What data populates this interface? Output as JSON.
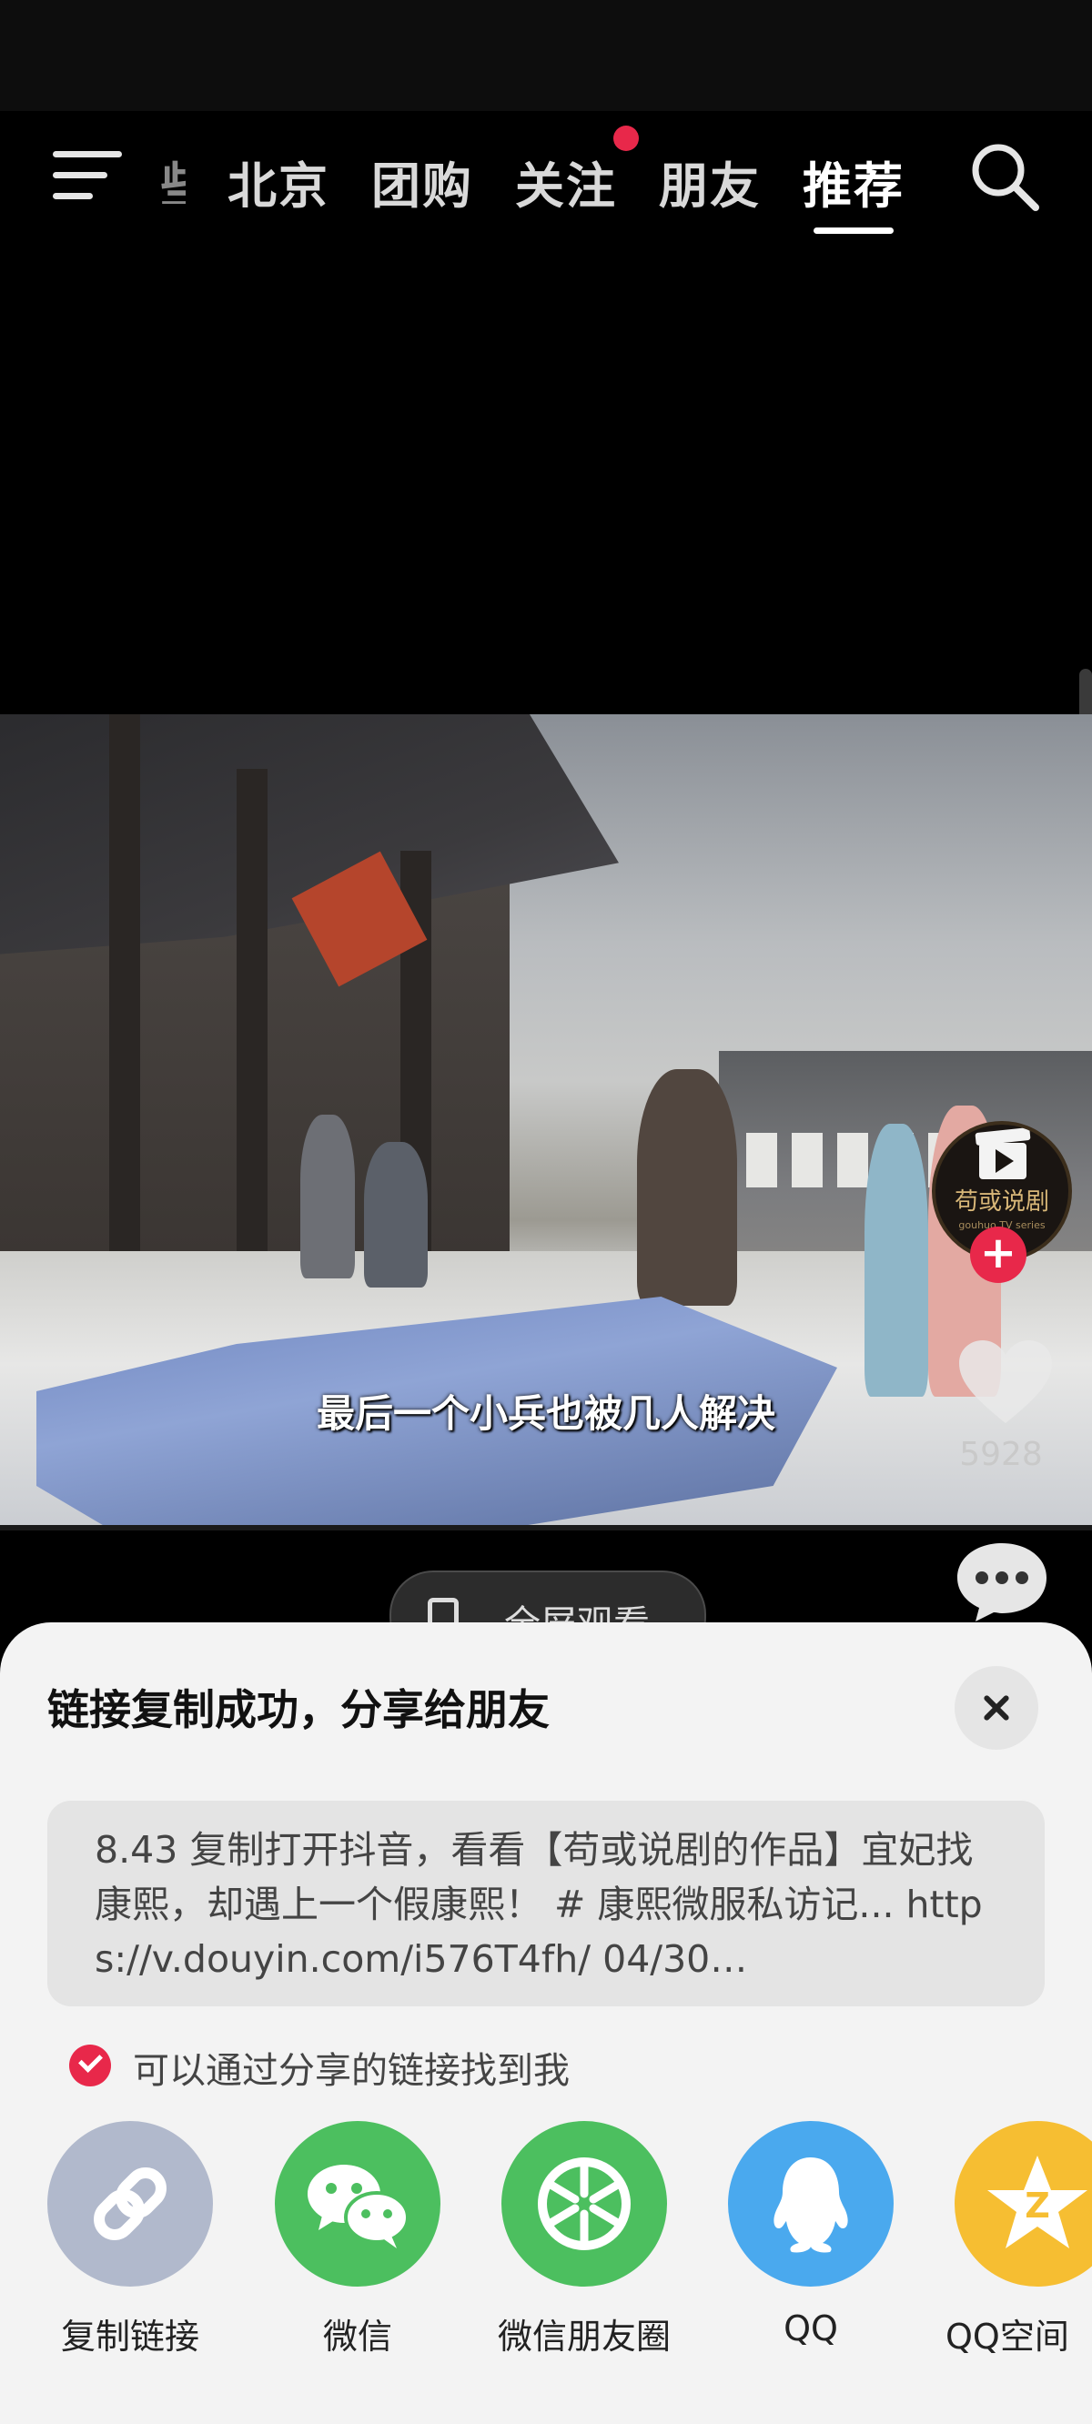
{
  "top_nav": {
    "clipped_tab": "些",
    "tabs": [
      {
        "label": "北京",
        "active": false
      },
      {
        "label": "团购",
        "active": false
      },
      {
        "label": "关注",
        "active": false,
        "has_dot": true
      },
      {
        "label": "朋友",
        "active": false
      },
      {
        "label": "推荐",
        "active": true
      }
    ]
  },
  "video": {
    "subtitle": "最后一个小兵也被几人解决"
  },
  "creator": {
    "avatar_text": "苟或说剧",
    "avatar_subtext": "gouhuo TV series",
    "follow_symbol": "+"
  },
  "actions": {
    "like_count": "5928"
  },
  "fullscreen": {
    "label": "全屏观看"
  },
  "share_sheet": {
    "title": "链接复制成功，分享给朋友",
    "share_text": "8.43 复制打开抖音，看看【苟或说剧的作品】宜妃找康熙，却遇上一个假康熙！ # 康熙微服私访记... https://v.douyin.com/i576T4fh/ 04/30…",
    "findable_option": "可以通过分享的链接找到我",
    "targets": [
      {
        "label": "复制链接",
        "icon": "link-icon",
        "color": "#b1b9cc"
      },
      {
        "label": "微信",
        "icon": "wechat-icon",
        "color": "#4cbf5f"
      },
      {
        "label": "微信朋友圈",
        "icon": "moments-icon",
        "color": "#4cbf5f"
      },
      {
        "label": "QQ",
        "icon": "qq-icon",
        "color": "#4aa9ee"
      },
      {
        "label": "QQ空间",
        "icon": "qzone-icon",
        "color": "#f6be32"
      }
    ]
  },
  "colors": {
    "accent": "#e8284a"
  }
}
